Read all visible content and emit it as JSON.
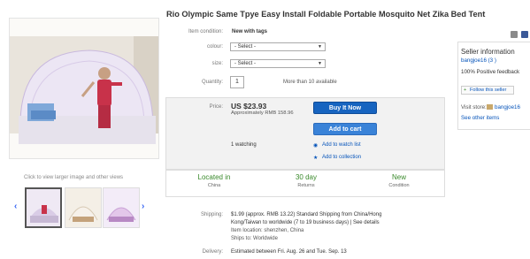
{
  "title": "Rio Olympic Same Tpye Easy Install Foldable Portable Mosquito Net Zika Bed Tent",
  "gallery": {
    "caption": "Click to view larger image and other views",
    "prev": "‹",
    "next": "›"
  },
  "item": {
    "condition_label": "Item condition:",
    "condition_value": "New with tags",
    "colour_label": "colour:",
    "colour_value": "- Select -",
    "size_label": "size:",
    "size_value": "- Select -",
    "quantity_label": "Quantity:",
    "quantity_value": "1",
    "quantity_note": "More than 10 available"
  },
  "buy": {
    "price_label": "Price:",
    "price": "US $23.93",
    "approx": "Approximately RMB 158.96",
    "buy_now": "Buy It Now",
    "add_to_cart": "Add to cart",
    "watching": "1 watching",
    "watch_list": "Add to watch list",
    "collection": "Add to collection"
  },
  "facts": [
    {
      "head": "Located in",
      "sub": "China"
    },
    {
      "head": "30 day",
      "sub": "Returns"
    },
    {
      "head": "New",
      "sub": "Condition"
    }
  ],
  "shipping": {
    "label": "Shipping:",
    "line1": "$1.99 (approx. RMB 13.22)   Standard Shipping from China/Hong",
    "line2": "Kong/Taiwan to worldwide (7 to 19 business days) | See details",
    "line3": "Item location: shenzhen, China",
    "line4": "Ships to: Worldwide"
  },
  "delivery": {
    "label": "Delivery:",
    "value": "Estimated between Fri. Aug. 26 and Tue. Sep. 13"
  },
  "seller": {
    "heading": "Seller information",
    "name": "bangjoe16 (3 )",
    "feedback": "100% Positive feedback",
    "follow": "Follow this seller",
    "visit_label": "Visit store:",
    "store": "bangjoe16",
    "other": "See other items"
  },
  "colors": {
    "accent": "#0654ba",
    "buy": "#1764c0",
    "green": "#3a8a2c"
  }
}
